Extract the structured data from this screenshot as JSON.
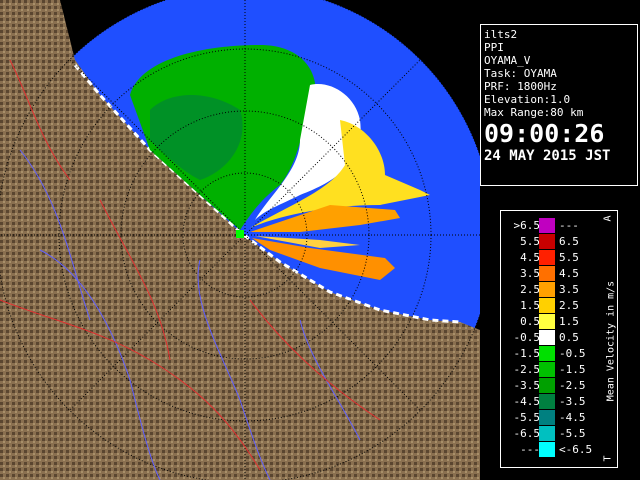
{
  "info": {
    "lines": [
      "ilts2",
      "PPI",
      "OYAMA_V",
      "Task: OYAMA",
      "PRF: 1800Hz",
      "Elevation:1.0",
      "Max Range:80 km"
    ],
    "time": "09:00:26",
    "date": "24 MAY 2015 JST"
  },
  "legend": {
    "title": "Mean Velocity in m/s",
    "corner_top": "A",
    "corner_bottom": "T",
    "rows": [
      {
        "left": ">6.5",
        "right": "---",
        "color": "#c000c0"
      },
      {
        "left": "5.5",
        "right": "6.5",
        "color": "#c80000"
      },
      {
        "left": "4.5",
        "right": "5.5",
        "color": "#ff2000"
      },
      {
        "left": "3.5",
        "right": "4.5",
        "color": "#ff7000"
      },
      {
        "left": "2.5",
        "right": "3.5",
        "color": "#ffa000"
      },
      {
        "left": "1.5",
        "right": "2.5",
        "color": "#ffd000"
      },
      {
        "left": "0.5",
        "right": "1.5",
        "color": "#ffff40"
      },
      {
        "left": "-0.5",
        "right": "0.5",
        "color": "#ffffff"
      },
      {
        "left": "-1.5",
        "right": "-0.5",
        "color": "#00e000"
      },
      {
        "left": "-2.5",
        "right": "-1.5",
        "color": "#00c000"
      },
      {
        "left": "-3.5",
        "right": "-2.5",
        "color": "#00a000"
      },
      {
        "left": "-4.5",
        "right": "-3.5",
        "color": "#008040"
      },
      {
        "left": "-5.5",
        "right": "-4.5",
        "color": "#008080"
      },
      {
        "left": "-6.5",
        "right": "-5.5",
        "color": "#00c0c0"
      },
      {
        "left": "---",
        "right": "<-6.5",
        "color": "#00ffff"
      }
    ]
  },
  "colors": {
    "sea": "#1f4fff",
    "land": "#8a7050",
    "range_bg": "#1f4fff"
  }
}
